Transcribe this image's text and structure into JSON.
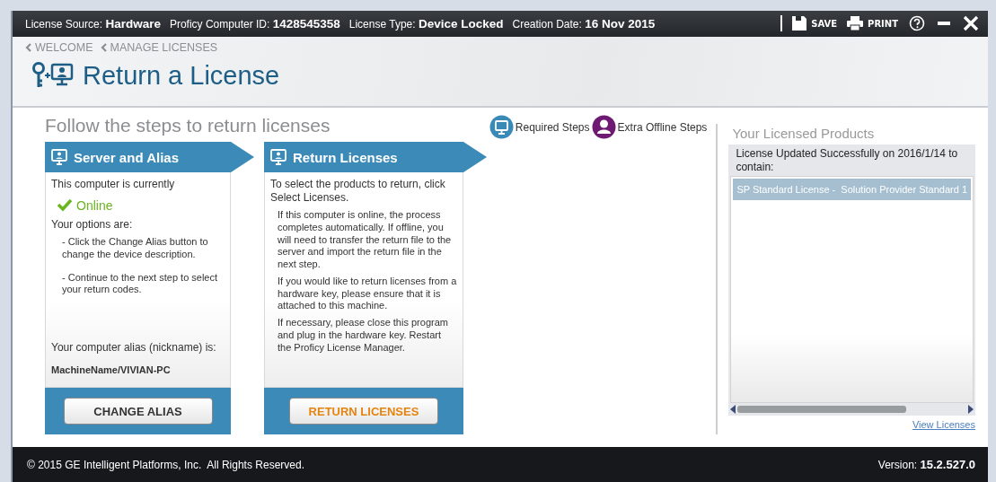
{
  "info_bar": [
    {
      "label": "License Source:",
      "value": "Hardware"
    },
    {
      "label": "Proficy Computer ID:",
      "value": "1428545358"
    },
    {
      "label": "License Type:",
      "value": "Device Locked"
    },
    {
      "label": "Creation Date:",
      "value": "16 Nov 2015"
    }
  ],
  "toolbar": [
    {
      "kind": "save",
      "label": "SAVE"
    },
    {
      "kind": "print",
      "label": "PRINT"
    }
  ],
  "breadcrumbs": [
    "WELCOME",
    "MANAGE LICENSES"
  ],
  "title": "Return a License",
  "subtitle": "Follow the steps to return licenses",
  "legend": [
    {
      "kind": "required",
      "label": "Required Steps",
      "color": "#3a8ab8"
    },
    {
      "kind": "offline",
      "label": "Extra Offline Steps",
      "color": "#6e1a72"
    }
  ],
  "steps": [
    {
      "title": "Server and Alias",
      "kind": "alias",
      "status_intro": "This computer is currently",
      "status": "Online",
      "options_label": "Your options are:",
      "options": [
        "- Click the Change Alias button to change the device description.",
        "- Continue to the next step to select your return codes."
      ],
      "alias_label": "Your computer alias (nickname) is:",
      "alias": "MachineName/VIVIAN-PC",
      "button": {
        "label": "CHANGE ALIAS",
        "highlighted": false
      }
    },
    {
      "title": "Return Licenses",
      "kind": "notes",
      "intro": "To select the products to return, click Select Licenses.",
      "notes": [
        "If this computer is online, the process completes automatically. If offline, you will need to transfer the return file to the server and import the return file in the next step.",
        "If you would like to return licenses from a hardware key, please ensure that it is attached to this machine.",
        "If necessary, please close this program and plug in the hardware key. Restart the Proficy License Manager."
      ],
      "button": {
        "label": "RETURN LICENSES",
        "highlighted": true
      }
    }
  ],
  "products": {
    "title": "Your Licensed Products",
    "message": "License Updated Successfully on 2016/1/14 to contain:",
    "items": [
      {
        "label": "SP Standard License -  Solution Provider Standard 1",
        "selected": true
      }
    ],
    "link": "View Licenses"
  },
  "footer": {
    "copyright": "© 2015 GE Intelligent Platforms, Inc.  All Rights Reserved.",
    "version_label": "Version:",
    "version": "15.2.527.0"
  }
}
